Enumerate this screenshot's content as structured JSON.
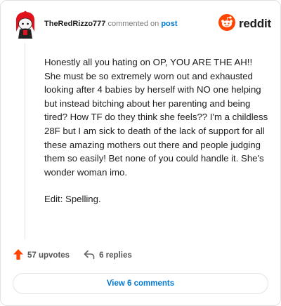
{
  "header": {
    "username": "TheRedRizzo777",
    "commented_text": "commented on",
    "post_link": "post",
    "brand_name": "reddit"
  },
  "comment": {
    "paragraphs": [
      "Honestly all you hating on OP, YOU ARE THE AH!! She must be so extremely worn out and exhausted looking after 4 babies by herself with NO one helping but instead bitching about her parenting and being tired? How TF do they think she feels?? I'm a childless 28F but I am sick to death of the lack of support for all these amazing mothers out there and people judging them so easily! Bet none of you could handle it. She's wonder woman imo.",
      "Edit: Spelling."
    ]
  },
  "actions": {
    "upvotes": "57 upvotes",
    "replies": "6 replies"
  },
  "footer": {
    "view_comments": "View 6 comments"
  },
  "colors": {
    "brand_orange": "#ff4500",
    "link_blue": "#0079d3"
  },
  "icons": {
    "avatar": "avatar-icon",
    "logo": "reddit-logo-icon",
    "upvote": "upvote-arrow-icon",
    "reply": "reply-arrow-icon"
  }
}
